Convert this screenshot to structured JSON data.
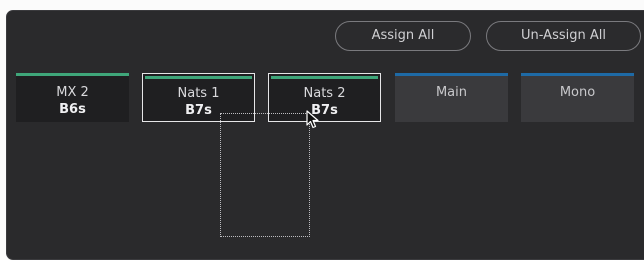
{
  "toolbar": {
    "assign_all": "Assign All",
    "unassign_all": "Un-Assign All"
  },
  "tiles": [
    {
      "name": "MX 2",
      "value": "B6s",
      "bar_color": "#3fa67a",
      "state": "normal"
    },
    {
      "name": "Nats 1",
      "value": "B7s",
      "bar_color": "#3fa67a",
      "state": "selected"
    },
    {
      "name": "Nats 2",
      "value": "B7s",
      "bar_color": "#3fa67a",
      "state": "selected"
    },
    {
      "name": "Main",
      "value": "",
      "bar_color": "#1e6aa6",
      "state": "unassigned"
    },
    {
      "name": "Mono",
      "value": "",
      "bar_color": "#1e6aa6",
      "state": "unassigned"
    }
  ],
  "icons": {
    "cursor": "arrow-pointer-icon"
  }
}
